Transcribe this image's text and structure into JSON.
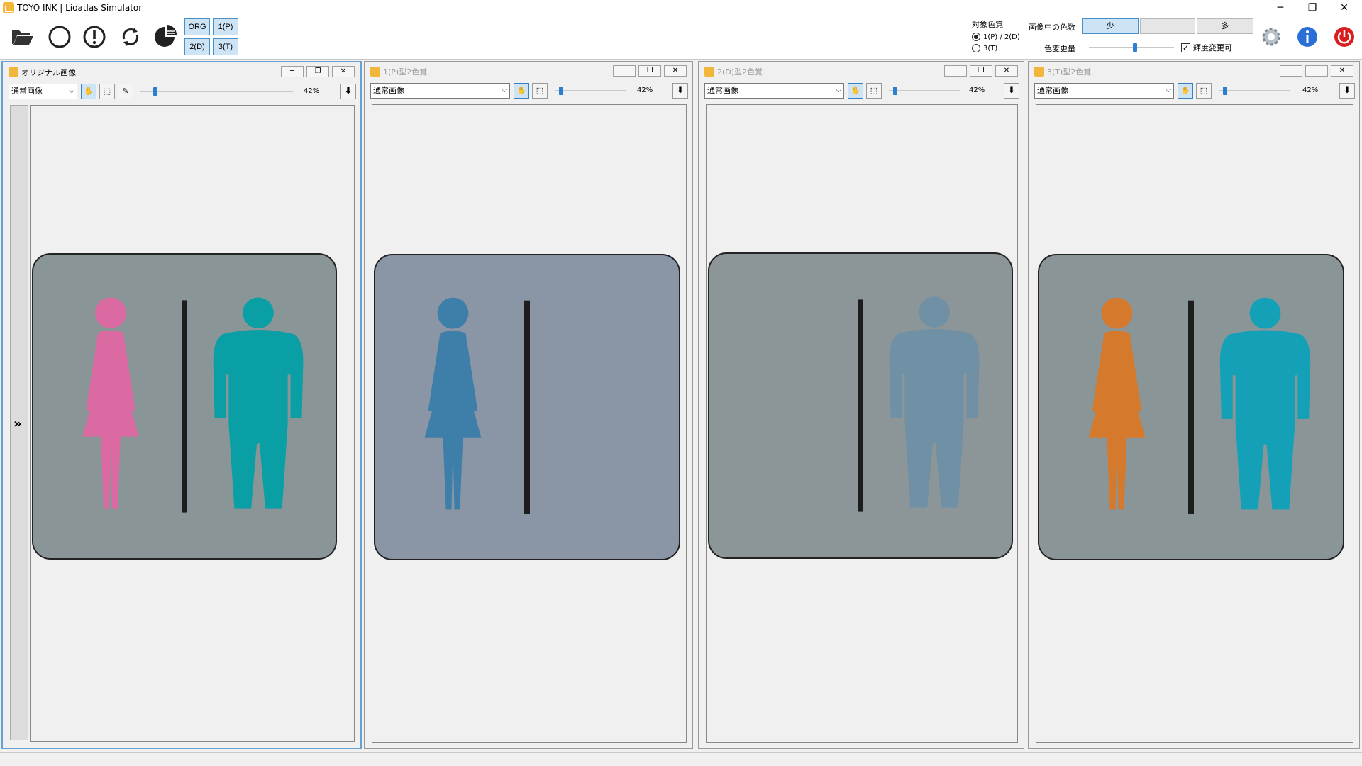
{
  "window": {
    "title": "TOYO INK | Lioatlas Simulator",
    "minimize_glyph": "─",
    "restore_glyph": "❐",
    "close_glyph": "✕"
  },
  "toolbar": {
    "icons": [
      "folder-open-icon",
      "circle-icon",
      "warning-circle-icon",
      "refresh-icon",
      "pie-chart-icon"
    ],
    "mode_buttons": {
      "org": "ORG",
      "p1": "1(P)",
      "d2": "2(D)",
      "t3": "3(T)"
    },
    "target_label": "対象色覚",
    "target_options": [
      "1(P) / 2(D)",
      "3(T)"
    ],
    "color_count_label": "画像中の色数",
    "segments": [
      "少",
      "",
      "多"
    ],
    "color_change_label": "色変更量",
    "checkbox_label": "輝度変更可",
    "colors": {
      "accent": "#2a7fd0",
      "power": "#d81e1e"
    }
  },
  "panels": [
    {
      "title": "オリジナル画像",
      "dim": false,
      "mode": "通常画像",
      "zoom": "42%",
      "sign": {
        "bg": "#8a9597",
        "woman": "#db6aa2",
        "man": "#0a9fa5",
        "divider": "#1d1d1d"
      }
    },
    {
      "title": "1(P)型2色覚",
      "dim": true,
      "mode": "通常画像",
      "zoom": "42%",
      "sign": {
        "bg": "#8a95a6",
        "woman": "#3d7fa8",
        "man": "#8a95a6",
        "divider": "#1d1d1d"
      }
    },
    {
      "title": "2(D)型2色覚",
      "dim": true,
      "mode": "通常画像",
      "zoom": "42%",
      "sign": {
        "bg": "#8c9598",
        "woman": "#8c9598",
        "man": "#7090a6",
        "divider": "#1d1d1d"
      }
    },
    {
      "title": "3(T)型2色覚",
      "dim": true,
      "mode": "通常画像",
      "zoom": "42%",
      "sign": {
        "bg": "#8a9597",
        "woman": "#d57a2c",
        "man": "#14a1b8",
        "divider": "#1d1d1d"
      }
    }
  ],
  "sidebar": {
    "expand_glyph": "»"
  }
}
